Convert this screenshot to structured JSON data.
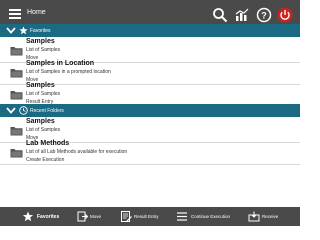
{
  "header": {
    "title": "Home",
    "icons": [
      "menu-icon",
      "search-icon",
      "chart-icon",
      "help-icon",
      "power-icon"
    ],
    "power_color": "#cc2222"
  },
  "favorites": {
    "label": "Favorites",
    "items": [
      {
        "title": "Samples",
        "description": "List of Samples",
        "action": "Move"
      },
      {
        "title": "Samples in Location",
        "description": "List of Samples in a prompted location",
        "action": "Move"
      },
      {
        "title": "Samples",
        "description": "List of Samples",
        "action": "Result Entry"
      }
    ]
  },
  "recent": {
    "label": "Recent Folders",
    "items": [
      {
        "title": "Samples",
        "description": "List of Samples",
        "action": "Move"
      },
      {
        "title": "Lab Methods",
        "description": "List of all Lab Methods available for execution",
        "action": "Create Execution"
      }
    ]
  },
  "bottom_nav": [
    {
      "label": "Favorites",
      "icon": "star-icon"
    },
    {
      "label": "Move",
      "icon": "move-icon"
    },
    {
      "label": "Result Entry",
      "icon": "result-entry-icon"
    },
    {
      "label": "Continue Execution",
      "icon": "list-icon"
    },
    {
      "label": "Receive",
      "icon": "receive-icon"
    }
  ],
  "colors": {
    "topbar": "#4a4a4a",
    "section_header": "#1b6a83",
    "bottombar": "#4a4a4a"
  }
}
